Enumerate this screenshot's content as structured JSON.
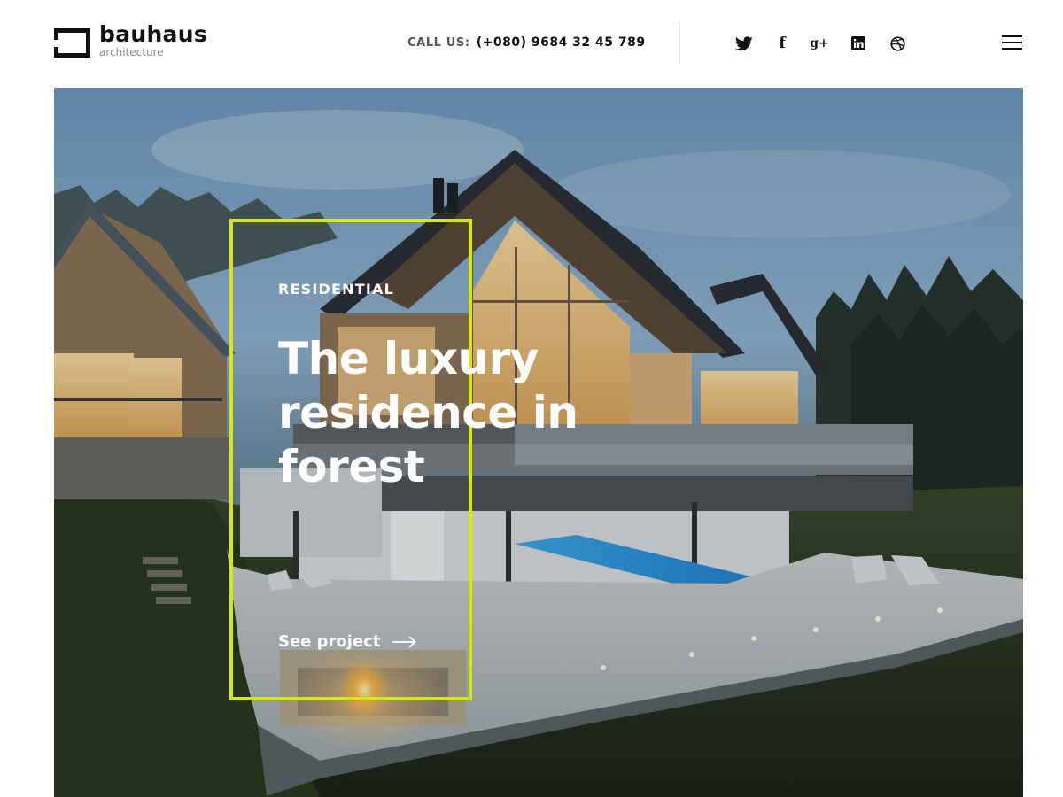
{
  "header": {
    "logo": {
      "name": "bauhaus",
      "tagline": "architecture"
    },
    "contact": {
      "label": "CALL US:",
      "phone": "(+080) 9684 32 45 789"
    },
    "social": [
      {
        "name": "twitter-icon"
      },
      {
        "name": "facebook-icon",
        "glyph": "f"
      },
      {
        "name": "google-plus-icon",
        "glyph": "g+"
      },
      {
        "name": "linkedin-icon"
      },
      {
        "name": "dribbble-icon"
      }
    ],
    "menu_icon": "hamburger-menu-icon"
  },
  "hero": {
    "category": "RESIDENTIAL",
    "title_lines": [
      "The luxury",
      "residence in",
      "forest"
    ],
    "cta_label": "See project",
    "cta_icon": "arrow-right-icon",
    "frame_color": "#d4e819",
    "image_icon": "house-photo"
  },
  "colors": {
    "accent": "#d4e819",
    "text_dark": "#111111",
    "text_muted": "#555555",
    "tagline": "#8a8a8a"
  }
}
